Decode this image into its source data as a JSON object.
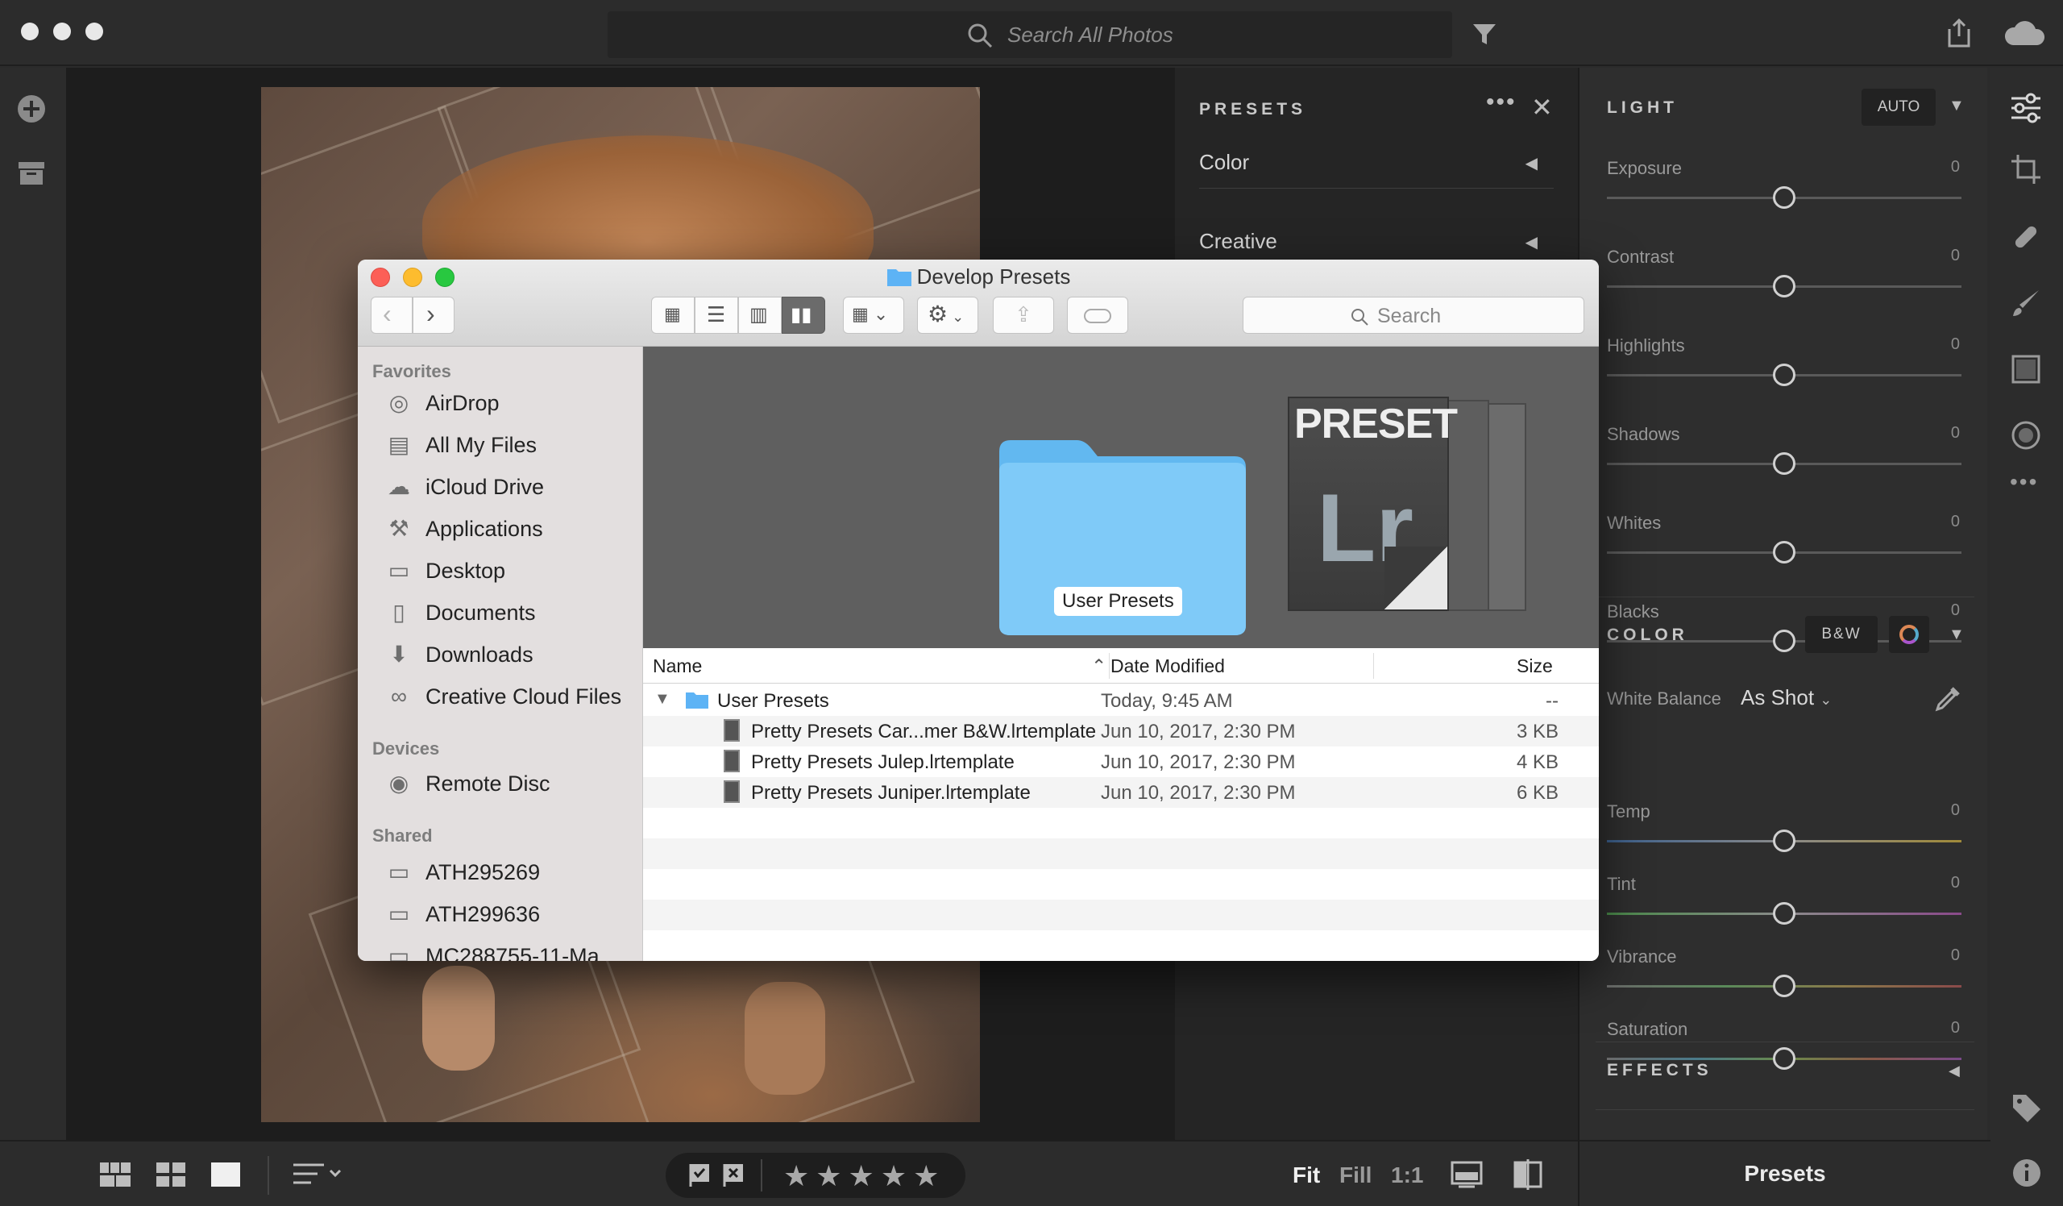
{
  "topbar": {
    "search_placeholder": "Search All Photos",
    "icons": [
      "search-icon",
      "filter-icon",
      "share-icon",
      "cloud-icon"
    ]
  },
  "presets_panel": {
    "title": "PRESETS",
    "items": [
      {
        "label": "Color"
      },
      {
        "label": "Creative"
      }
    ]
  },
  "light": {
    "title": "LIGHT",
    "auto_label": "AUTO",
    "sliders": [
      {
        "label": "Exposure",
        "value": "0"
      },
      {
        "label": "Contrast",
        "value": "0"
      },
      {
        "label": "Highlights",
        "value": "0"
      },
      {
        "label": "Shadows",
        "value": "0"
      },
      {
        "label": "Whites",
        "value": "0"
      },
      {
        "label": "Blacks",
        "value": "0"
      }
    ]
  },
  "color": {
    "title": "COLOR",
    "bw_label": "B&W",
    "wb_label": "White Balance",
    "wb_value": "As Shot",
    "sliders": [
      {
        "label": "Temp",
        "value": "0"
      },
      {
        "label": "Tint",
        "value": "0"
      },
      {
        "label": "Vibrance",
        "value": "0"
      },
      {
        "label": "Saturation",
        "value": "0"
      }
    ]
  },
  "effects": {
    "title": "EFFECTS"
  },
  "bottombar": {
    "fit_label": "Fit",
    "fill_label": "Fill",
    "one_to_one_label": "1:1",
    "presets_label": "Presets",
    "stars": "★★★★★"
  },
  "finder": {
    "title": "Develop Presets",
    "search_placeholder": "Search",
    "sidebar": {
      "favorites_label": "Favorites",
      "favorites": [
        {
          "label": "AirDrop",
          "icon": "airdrop-icon"
        },
        {
          "label": "All My Files",
          "icon": "all-files-icon"
        },
        {
          "label": "iCloud Drive",
          "icon": "icloud-icon"
        },
        {
          "label": "Applications",
          "icon": "applications-icon"
        },
        {
          "label": "Desktop",
          "icon": "desktop-icon"
        },
        {
          "label": "Documents",
          "icon": "documents-icon"
        },
        {
          "label": "Downloads",
          "icon": "downloads-icon"
        },
        {
          "label": "Creative Cloud Files",
          "icon": "creative-cloud-icon"
        }
      ],
      "devices_label": "Devices",
      "devices": [
        {
          "label": "Remote Disc",
          "icon": "disc-icon"
        }
      ],
      "shared_label": "Shared",
      "shared": [
        {
          "label": "ATH295269",
          "icon": "computer-icon"
        },
        {
          "label": "ATH299636",
          "icon": "computer-icon"
        },
        {
          "label": "MC288755-11-Ma",
          "icon": "computer-icon"
        }
      ]
    },
    "cover": {
      "folder_label": "User Presets",
      "preset_text": "PRESET",
      "lr_text": "Lr"
    },
    "columns": {
      "name": "Name",
      "date": "Date Modified",
      "size": "Size"
    },
    "rows": [
      {
        "name": "User Presets",
        "date": "Today, 9:45 AM",
        "size": "--"
      },
      {
        "name": "Pretty Presets Car...mer B&W.lrtemplate",
        "date": "Jun 10, 2017, 2:30 PM",
        "size": "3 KB"
      },
      {
        "name": "Pretty Presets Julep.lrtemplate",
        "date": "Jun 10, 2017, 2:30 PM",
        "size": "4 KB"
      },
      {
        "name": "Pretty Presets Juniper.lrtemplate",
        "date": "Jun 10, 2017, 2:30 PM",
        "size": "6 KB"
      }
    ]
  }
}
